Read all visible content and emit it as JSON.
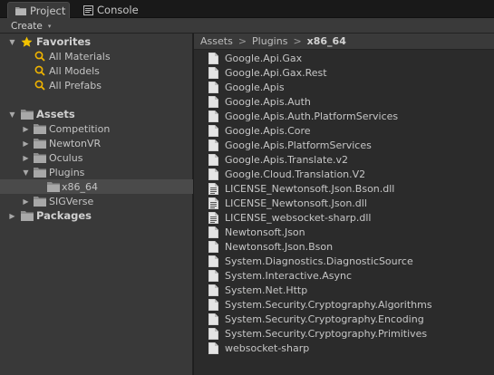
{
  "tabs": [
    {
      "label": "Project",
      "icon": "folder-icon",
      "active": true
    },
    {
      "label": "Console",
      "icon": "console-icon",
      "active": false
    }
  ],
  "toolbar": {
    "create_label": "Create",
    "create_caret": "▾"
  },
  "tree": {
    "favorites": {
      "label": "Favorites",
      "items": [
        "All Materials",
        "All Models",
        "All Prefabs"
      ]
    },
    "assets": {
      "label": "Assets",
      "children": [
        "Competition",
        "NewtonVR",
        "Oculus",
        "Plugins",
        "x86_64",
        "SIGVerse"
      ]
    },
    "packages": {
      "label": "Packages"
    }
  },
  "breadcrumb": {
    "parts": [
      "Assets",
      "Plugins"
    ],
    "current": "x86_64",
    "separator": ">"
  },
  "files": [
    {
      "name": "Google.Api.Gax",
      "icon": "file-icon"
    },
    {
      "name": "Google.Api.Gax.Rest",
      "icon": "file-icon"
    },
    {
      "name": "Google.Apis",
      "icon": "file-icon"
    },
    {
      "name": "Google.Apis.Auth",
      "icon": "file-icon"
    },
    {
      "name": "Google.Apis.Auth.PlatformServices",
      "icon": "file-icon"
    },
    {
      "name": "Google.Apis.Core",
      "icon": "file-icon"
    },
    {
      "name": "Google.Apis.PlatformServices",
      "icon": "file-icon"
    },
    {
      "name": "Google.Apis.Translate.v2",
      "icon": "file-icon"
    },
    {
      "name": "Google.Cloud.Translation.V2",
      "icon": "file-icon"
    },
    {
      "name": "LICENSE_Newtonsoft.Json.Bson.dll",
      "icon": "text-file-icon"
    },
    {
      "name": "LICENSE_Newtonsoft.Json.dll",
      "icon": "text-file-icon"
    },
    {
      "name": "LICENSE_websocket-sharp.dll",
      "icon": "text-file-icon"
    },
    {
      "name": "Newtonsoft.Json",
      "icon": "file-icon"
    },
    {
      "name": "Newtonsoft.Json.Bson",
      "icon": "file-icon"
    },
    {
      "name": "System.Diagnostics.DiagnosticSource",
      "icon": "file-icon"
    },
    {
      "name": "System.Interactive.Async",
      "icon": "file-icon"
    },
    {
      "name": "System.Net.Http",
      "icon": "file-icon"
    },
    {
      "name": "System.Security.Cryptography.Algorithms",
      "icon": "file-icon"
    },
    {
      "name": "System.Security.Cryptography.Encoding",
      "icon": "file-icon"
    },
    {
      "name": "System.Security.Cryptography.Primitives",
      "icon": "file-icon"
    },
    {
      "name": "websocket-sharp",
      "icon": "file-icon"
    }
  ],
  "colors": {
    "selected_row": "#4a4a4a",
    "star": "#f2c200",
    "search": "#f0b400",
    "folder": "#9a9a9a"
  }
}
